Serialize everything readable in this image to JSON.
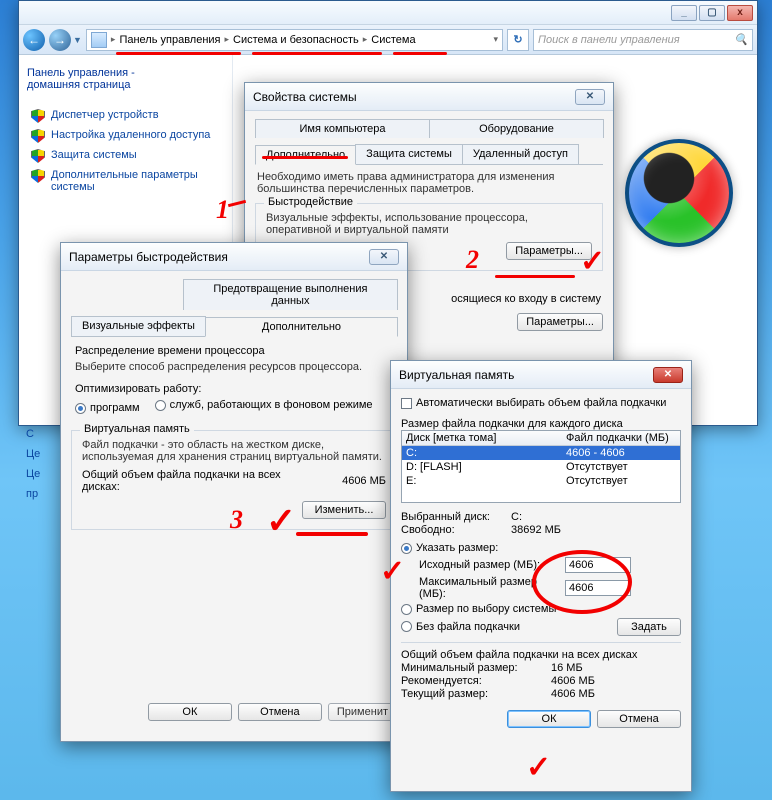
{
  "explorer": {
    "title_buttons": {
      "minimize": "_",
      "maximize": "▢",
      "close": "x"
    },
    "breadcrumb": {
      "items": [
        "Панель управления",
        "Система и безопасность",
        "Система"
      ]
    },
    "search_placeholder": "Поиск в панели управления",
    "sidebar": {
      "heading_line1": "Панель управления -",
      "heading_line2": "домашняя страница",
      "tasks": [
        "Диспетчер устройств",
        "Настройка удаленного доступа",
        "Защита системы",
        "Дополнительные параметры системы"
      ]
    },
    "left_cut": [
      "С",
      "Це",
      "Це",
      "пр"
    ]
  },
  "sys_props": {
    "title": "Свойства системы",
    "tabs_row1": [
      "Имя компьютера",
      "Оборудование"
    ],
    "tabs_row2": [
      "Дополнительно",
      "Защита системы",
      "Удаленный доступ"
    ],
    "note": "Необходимо иметь права администратора для изменения большинства перечисленных параметров.",
    "group_perf_title": "Быстродействие",
    "group_perf_text": "Визуальные эффекты, использование процессора, оперативной и виртуальной памяти",
    "btn_params": "Параметры...",
    "group_profiles_text": "осящиеся ко входу в систему"
  },
  "perf_opts": {
    "title": "Параметры быстродействия",
    "tabs_row1": [
      "Предотвращение выполнения данных"
    ],
    "tabs_row2": [
      "Визуальные эффекты",
      "Дополнительно"
    ],
    "sched_h": "Распределение времени процессора",
    "sched_text": "Выберите способ распределения ресурсов процессора.",
    "opt_label": "Оптимизировать работу:",
    "opt_programs": "программ",
    "opt_services": "служб, работающих в фоновом режиме",
    "vm_group": "Виртуальная память",
    "vm_text": "Файл подкачки - это область на жестком диске, используемая для хранения страниц виртуальной памяти.",
    "vm_total_label": "Общий объем файла подкачки на всех дисках:",
    "vm_total_value": "4606 МБ",
    "btn_change": "Изменить...",
    "btn_ok": "ОК",
    "btn_cancel": "Отмена",
    "btn_apply": "Применит"
  },
  "vm": {
    "title": "Виртуальная память",
    "auto": "Автоматически выбирать объем файла подкачки",
    "per_disk": "Размер файла подкачки для каждого диска",
    "head_disk": "Диск [метка тома]",
    "head_size": "Файл подкачки (МБ)",
    "rows": [
      {
        "disk": "C:",
        "size": "4606 - 4606"
      },
      {
        "disk": "D:     [FLASH]",
        "size": "Отсутствует"
      },
      {
        "disk": "E:",
        "size": "Отсутствует"
      }
    ],
    "sel_disk_label": "Выбранный диск:",
    "sel_disk_value": "C:",
    "free_label": "Свободно:",
    "free_value": "38692 МБ",
    "opt_custom": "Указать размер:",
    "init_label": "Исходный размер (МБ):",
    "init_value": "4606",
    "max_label": "Максимальный размер (МБ):",
    "max_value": "4606",
    "opt_system": "Размер по выбору системы",
    "opt_none": "Без файла подкачки",
    "btn_set": "Задать",
    "total_h": "Общий объем файла подкачки на всех дисках",
    "min_label": "Минимальный размер:",
    "min_value": "16 МБ",
    "rec_label": "Рекомендуется:",
    "rec_value": "4606 МБ",
    "cur_label": "Текущий размер:",
    "cur_value": "4606 МБ",
    "btn_ok": "ОК",
    "btn_cancel": "Отмена"
  }
}
